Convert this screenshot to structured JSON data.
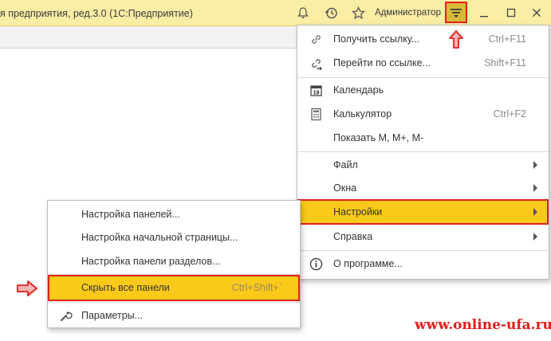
{
  "window": {
    "title": "я предприятия, ред.3.0  (1С:Предприятие)",
    "user": "Администратор"
  },
  "titlebar_icons": [
    "bell-icon",
    "history-icon",
    "star-icon",
    "hamburger-menu-icon",
    "minimize-icon",
    "maximize-icon",
    "close-icon"
  ],
  "main_menu": {
    "items": [
      {
        "label": "Получить ссылку...",
        "shortcut": "Ctrl+F11",
        "icon": "link-icon"
      },
      {
        "label": "Перейти по ссылке...",
        "shortcut": "Shift+F11",
        "icon": "goto-link-icon"
      },
      {
        "label": "Календарь",
        "shortcut": "",
        "icon": "calendar-icon",
        "icon_text": "19"
      },
      {
        "label": "Калькулятор",
        "shortcut": "Ctrl+F2",
        "icon": "calculator-icon"
      },
      {
        "label": "Показать M, M+, M-",
        "shortcut": ""
      },
      {
        "label": "Файл",
        "submenu": true
      },
      {
        "label": "Окна",
        "submenu": true
      },
      {
        "label": "Настройки",
        "submenu": true,
        "highlighted": true
      },
      {
        "label": "Справка",
        "submenu": true
      },
      {
        "label": "О программе...",
        "icon": "info-icon"
      }
    ]
  },
  "settings_submenu": {
    "items": [
      {
        "label": "Настройка панелей..."
      },
      {
        "label": "Настройка начальной страницы..."
      },
      {
        "label": "Настройка панели разделов..."
      },
      {
        "label": "Скрыть все панели",
        "shortcut": "Ctrl+Shift+`",
        "highlighted": true
      },
      {
        "label": "Параметры...",
        "icon": "wrench-icon"
      }
    ]
  },
  "watermark": "www.online-ufa.ru",
  "colors": {
    "titlebar": "#fbeda4",
    "highlight": "#fbc91a",
    "annotation_red": "#e0201d"
  }
}
